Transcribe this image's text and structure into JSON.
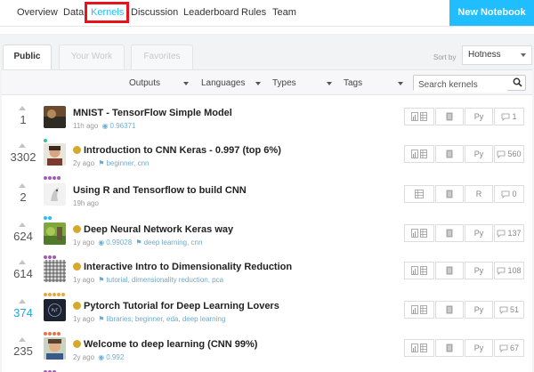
{
  "nav": {
    "items": [
      "Overview",
      "Data",
      "Kernels",
      "Discussion",
      "Leaderboard",
      "Rules",
      "Team"
    ],
    "new_notebook": "New Notebook"
  },
  "tabs": [
    "Public",
    "Your Work",
    "Favorites"
  ],
  "sort": {
    "label": "Sort by",
    "value": "Hotness"
  },
  "filters": [
    "Outputs",
    "Languages",
    "Types",
    "Tags"
  ],
  "search": {
    "placeholder": "Search kernels"
  },
  "colors": {
    "accent": "#20beff",
    "highlight": "#e8141b",
    "medal": "#d4a92e"
  },
  "kernels": [
    {
      "votes": "1",
      "title": "MNIST - TensorFlow Simple Model",
      "age": "11h ago",
      "score": "0.96371",
      "tags": "",
      "lang": "Py",
      "comments": "1",
      "medal": false,
      "tier": [
        "#3bbf9b"
      ],
      "thumb": "photo"
    },
    {
      "votes": "3302",
      "title": "Introduction to CNN Keras - 0.997 (top 6%)",
      "age": "2y ago",
      "score": "",
      "tags": "beginner, cnn",
      "lang": "Py",
      "comments": "560",
      "medal": true,
      "tier": [
        "#a45bb5",
        "#a45bb5",
        "#a45bb5",
        "#a45bb5"
      ],
      "thumb": "face"
    },
    {
      "votes": "2",
      "title": "Using R and Tensorflow to build CNN",
      "age": "19h ago",
      "score": "",
      "tags": "",
      "lang": "R",
      "comments": "0",
      "medal": false,
      "tier": [
        "#20beff",
        "#20beff"
      ],
      "thumb": "bird"
    },
    {
      "votes": "624",
      "title": "Deep Neural Network Keras way",
      "age": "1y ago",
      "score": "0.99028",
      "tags": "deep learning, cnn",
      "lang": "Py",
      "comments": "137",
      "medal": true,
      "tier": [
        "#a45bb5",
        "#a45bb5",
        "#a45bb5"
      ],
      "thumb": "nature"
    },
    {
      "votes": "614",
      "title": "Interactive Intro to Dimensionality Reduction",
      "age": "1y ago",
      "score": "",
      "tags": "tutorial, dimensionality reduction, pca",
      "lang": "Py",
      "comments": "108",
      "medal": true,
      "tier": [
        "#e8a83a",
        "#e8a83a",
        "#e8a83a",
        "#e8a83a",
        "#e8a83a"
      ],
      "thumb": "grid"
    },
    {
      "votes": "374",
      "title": "Pytorch Tutorial for Deep Learning Lovers",
      "age": "1y ago",
      "score": "",
      "tags": "libraries, beginner, eda, deep learning",
      "lang": "Py",
      "comments": "51",
      "medal": true,
      "tier": [
        "#e8734a",
        "#e8734a",
        "#e8734a",
        "#e8734a"
      ],
      "thumb": "dark"
    },
    {
      "votes": "235",
      "title": "Welcome to deep learning (CNN 99%)",
      "age": "2y ago",
      "score": "0.992",
      "tags": "",
      "lang": "Py",
      "comments": "67",
      "medal": true,
      "tier": [
        "#a45bb5",
        "#a45bb5",
        "#a45bb5"
      ],
      "thumb": "face2"
    }
  ]
}
